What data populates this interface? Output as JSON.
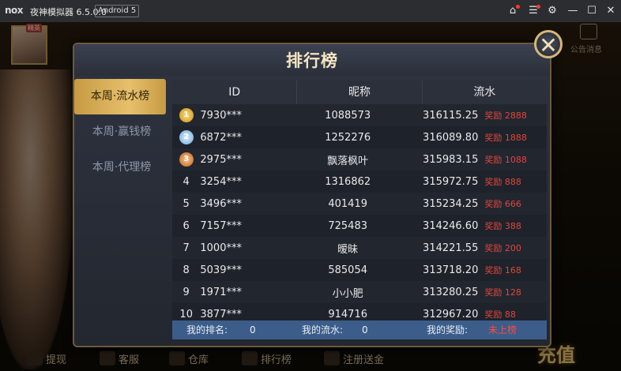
{
  "titlebar": {
    "logo": "nox",
    "app_title": "夜神模拟器 6.5.0.0",
    "android_badge": "Android 5",
    "icons": [
      "gift-icon",
      "menu-icon",
      "settings-icon",
      "minimize-icon",
      "maximize-icon",
      "close-icon"
    ]
  },
  "game": {
    "vip_label": "精英",
    "notice_label": "公告消息",
    "bottom_menu": [
      "提现",
      "客服",
      "仓库",
      "排行榜",
      "注册送金"
    ],
    "recharge_label": "充值"
  },
  "dialog": {
    "title": "排行榜",
    "close_label": "✕",
    "tabs": [
      {
        "label": "本周·流水榜",
        "active": true
      },
      {
        "label": "本周·赢钱榜",
        "active": false
      },
      {
        "label": "本周·代理榜",
        "active": false
      }
    ],
    "columns": [
      "ID",
      "昵称",
      "流水"
    ],
    "rows": [
      {
        "rank": "1",
        "id": "7930***",
        "nick": "1088573",
        "flow": "316115.25",
        "reward": "奖励 2888"
      },
      {
        "rank": "2",
        "id": "6872***",
        "nick": "1252276",
        "flow": "316089.80",
        "reward": "奖励 1888"
      },
      {
        "rank": "3",
        "id": "2975***",
        "nick": "飘落枫叶",
        "flow": "315983.15",
        "reward": "奖励 1088"
      },
      {
        "rank": "4",
        "id": "3254***",
        "nick": "1316862",
        "flow": "315972.75",
        "reward": "奖励 888"
      },
      {
        "rank": "5",
        "id": "3496***",
        "nick": "401419",
        "flow": "315234.25",
        "reward": "奖励 666"
      },
      {
        "rank": "6",
        "id": "7157***",
        "nick": "725483",
        "flow": "314246.60",
        "reward": "奖励 388"
      },
      {
        "rank": "7",
        "id": "1000***",
        "nick": "暧昧",
        "flow": "314221.55",
        "reward": "奖励 200"
      },
      {
        "rank": "8",
        "id": "5039***",
        "nick": "585054",
        "flow": "313718.20",
        "reward": "奖励 168"
      },
      {
        "rank": "9",
        "id": "1971***",
        "nick": "小小肥",
        "flow": "313280.25",
        "reward": "奖励 128"
      },
      {
        "rank": "10",
        "id": "3877***",
        "nick": "914716",
        "flow": "312967.20",
        "reward": "奖励 88"
      }
    ],
    "footer": {
      "my_rank_label": "我的排名:",
      "my_rank_value": "0",
      "my_flow_label": "我的流水:",
      "my_flow_value": "0",
      "my_reward_label": "我的奖励:",
      "my_reward_value": "未上榜"
    }
  },
  "colors": {
    "accent_gold": "#d6b777",
    "reward_red": "#e0463a",
    "footer_blue": "#3c5d8a"
  }
}
